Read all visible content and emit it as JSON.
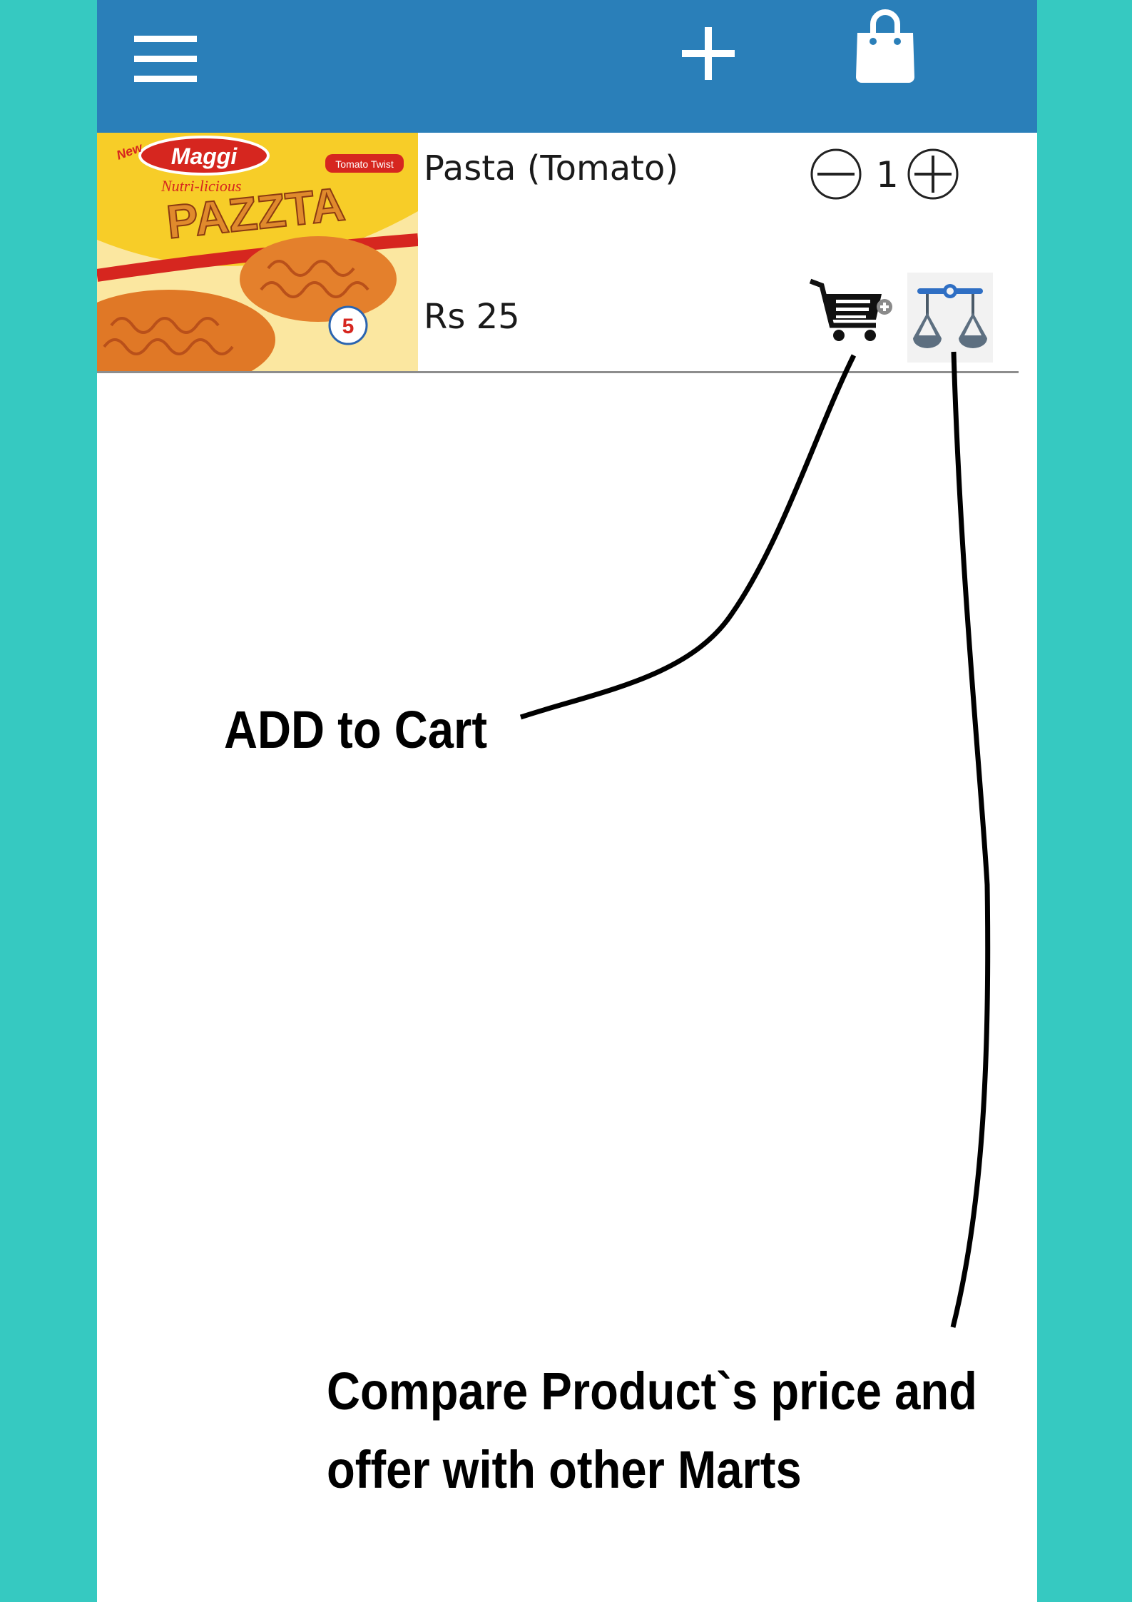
{
  "topbar": {
    "menu_icon": "menu-icon",
    "add_icon": "plus-icon",
    "bag_icon": "shopping-bag-icon",
    "color": "#2a7fb9"
  },
  "item": {
    "image_brand": "Maggi",
    "image_new": "New",
    "image_tagline": "Nutri-licious",
    "image_title": "PAZZTA",
    "image_flavour": "Tomato Twist",
    "name": "Pasta (Tomato)",
    "price": "Rs 25",
    "quantity": "1"
  },
  "annotations": {
    "add_to_cart": "ADD to Cart",
    "compare_line1": "Compare Product`s price and",
    "compare_line2": "offer with other Marts"
  },
  "colors": {
    "background": "#36c9c1",
    "accent": "#2a7fb9",
    "compare_icon": "#2f6fc4"
  }
}
